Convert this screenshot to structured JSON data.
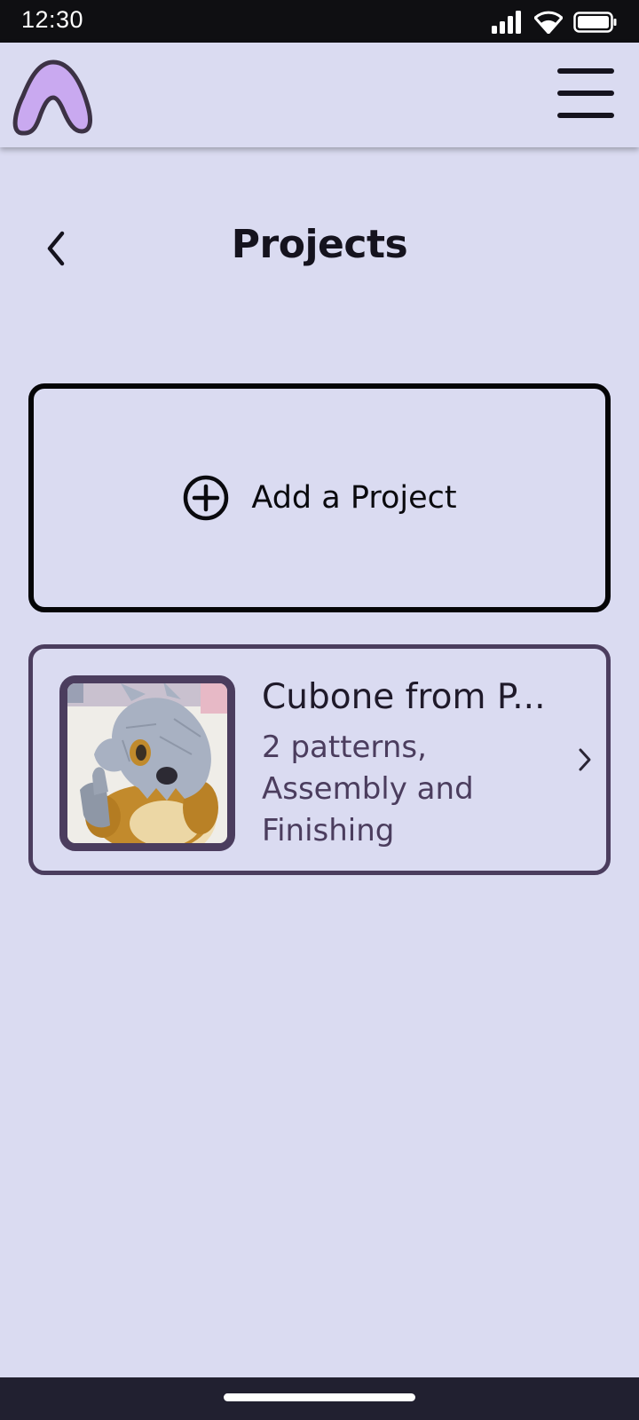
{
  "status_bar": {
    "time": "12:30",
    "icons": [
      "signal-icon",
      "wifi-icon",
      "battery-icon"
    ]
  },
  "app_bar": {
    "logo": "app-logo",
    "menu_icon": "hamburger-menu-icon"
  },
  "header": {
    "back_icon": "chevron-left-icon",
    "title": "Projects"
  },
  "add_project": {
    "icon": "plus-circle-icon",
    "label": "Add a Project"
  },
  "projects": [
    {
      "name": "Cubone from P...",
      "subtitle": "2 patterns, Assembly and Finishing",
      "thumbnail": "crochet-cubone-photo",
      "chevron_icon": "chevron-right-icon"
    }
  ],
  "colors": {
    "background": "#DADBF1",
    "accent_purple": "#C9A9F0",
    "card_border": "#4B3D5E",
    "dark": "#15131E",
    "status_bar": "#0F0F12",
    "nav_bar": "#212030"
  }
}
